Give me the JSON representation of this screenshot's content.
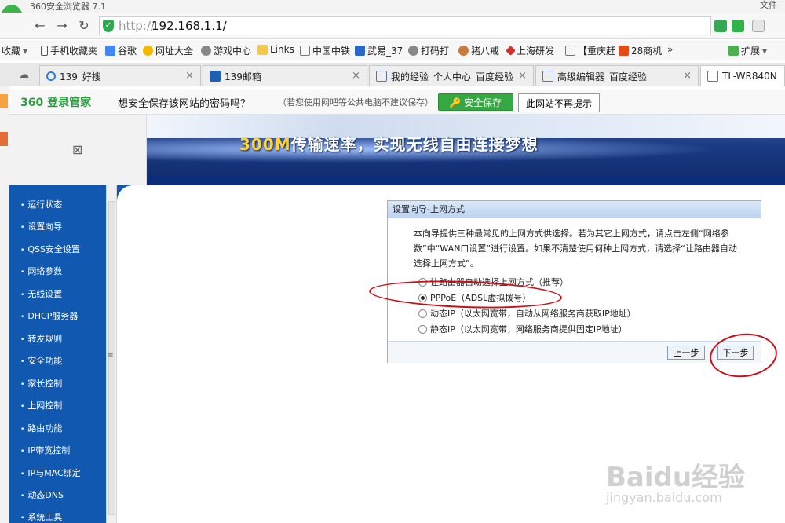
{
  "browser": {
    "title": "360安全浏览器 7.1",
    "top_right": "文件",
    "address_protocol": "http://",
    "address_host": "192.168.1.1/"
  },
  "bookmarks": [
    {
      "label": "收藏"
    },
    {
      "label": "手机收藏夹"
    },
    {
      "label": "谷歌"
    },
    {
      "label": "网址大全"
    },
    {
      "label": "游戏中心"
    },
    {
      "label": "Links"
    },
    {
      "label": "中国中铁"
    },
    {
      "label": "武易_37"
    },
    {
      "label": "打码打"
    },
    {
      "label": "猪八戒"
    },
    {
      "label": "上海研发"
    },
    {
      "label": "【重庆赶"
    },
    {
      "label": "28商机"
    },
    {
      "label": "»"
    },
    {
      "label": "扩展"
    }
  ],
  "tabs": [
    {
      "label": "139_好搜"
    },
    {
      "label": "139邮箱"
    },
    {
      "label": "我的经验_个人中心_百度经验"
    },
    {
      "label": "高级编辑器_百度经验"
    },
    {
      "label": "TL-WR840N"
    }
  ],
  "password_bar": {
    "brand": "360 登录管家",
    "message": "想安全保存该网站的密码吗？",
    "note": "（若您使用网吧等公共电脑不建议保存）",
    "save_label": "安全保存",
    "never_label": "此网站不再提示"
  },
  "banner": {
    "slogan_highlight": "300M",
    "slogan_rest": "传输速率，实现无线自由连接梦想"
  },
  "menu": [
    {
      "label": "运行状态"
    },
    {
      "label": "设置向导"
    },
    {
      "label": "QSS安全设置"
    },
    {
      "label": "网络参数"
    },
    {
      "label": "无线设置"
    },
    {
      "label": "DHCP服务器"
    },
    {
      "label": "转发规则"
    },
    {
      "label": "安全功能"
    },
    {
      "label": "家长控制"
    },
    {
      "label": "上网控制"
    },
    {
      "label": "路由功能"
    },
    {
      "label": "IP带宽控制"
    },
    {
      "label": "IP与MAC绑定"
    },
    {
      "label": "动态DNS"
    },
    {
      "label": "系统工具"
    }
  ],
  "wizard": {
    "title": "设置向导-上网方式",
    "description": "本向导提供三种最常见的上网方式供选择。若为其它上网方式，请点击左侧“网络参数”中“WAN口设置”进行设置。如果不清楚使用何种上网方式，请选择“让路由器自动选择上网方式”。",
    "options": [
      {
        "label": "让路由器自动选择上网方式（推荐）",
        "selected": false
      },
      {
        "label": "PPPoE（ADSL虚拟拨号）",
        "selected": true
      },
      {
        "label": "动态IP（以太网宽带，自动从网络服务商获取IP地址）",
        "selected": false
      },
      {
        "label": "静态IP（以太网宽带，网络服务商提供固定IP地址）",
        "selected": false
      }
    ],
    "prev_label": "上一步",
    "next_label": "下一步"
  },
  "watermark": {
    "main": "Baidu经验",
    "sub": "jingyan.baidu.com"
  },
  "colors": {
    "menu_bg": "#1058b0",
    "annotation": "#c8101a",
    "brand_green": "#2c9d3f"
  }
}
